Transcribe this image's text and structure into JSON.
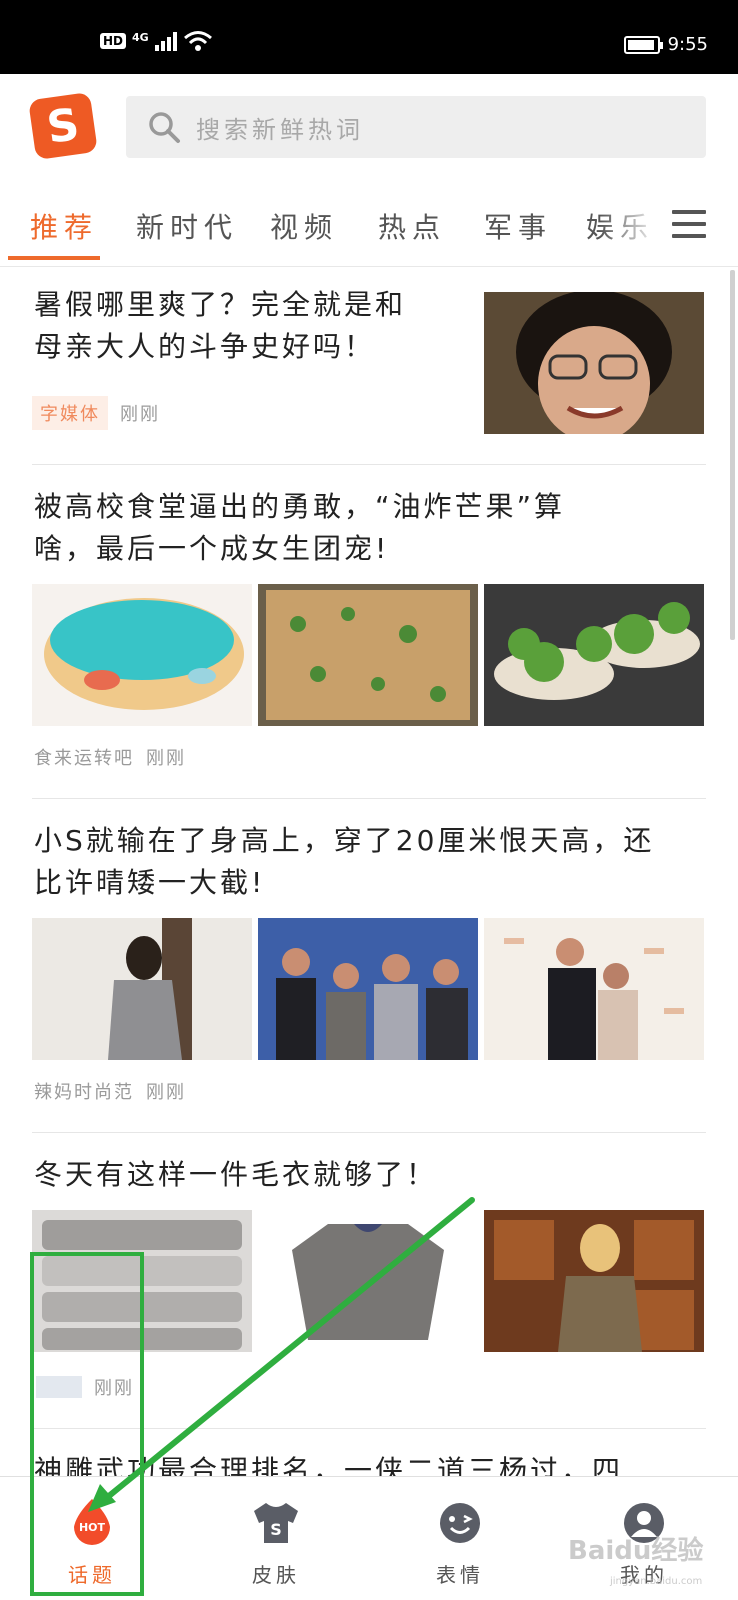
{
  "status_bar": {
    "hd": "HD",
    "network": "4G",
    "time": "9:55"
  },
  "header": {
    "logo_letter": "S",
    "search_placeholder": "搜索新鲜热词"
  },
  "tabs": [
    "推荐",
    "新时代",
    "视频",
    "热点",
    "军事",
    "娱乐"
  ],
  "active_tab": "推荐",
  "articles": [
    {
      "title_line1": "暑假哪里爽了？完全就是和",
      "title_line2": "母亲大人的斗争史好吗！",
      "tag": "字媒体",
      "time": "刚刚"
    },
    {
      "title_line1": "被高校食堂逼出的勇敢，“油炸芒果”算",
      "title_line2": "啥，最后一个成女生团宠!",
      "source": "食来运转吧",
      "time": "刚刚"
    },
    {
      "title_line1": "小S就输在了身高上，穿了20厘米恨天高，还",
      "title_line2": "比许晴矮一大截!",
      "source": "辣妈时尚范",
      "time": "刚刚"
    },
    {
      "title_line1": "冬天有这样一件毛衣就够了！",
      "time": "刚刚"
    },
    {
      "title_line1": "神雕武功最合理排名，一侠二道三杨过，四"
    }
  ],
  "bottom_nav": [
    {
      "label": "话题",
      "icon": "hot-icon",
      "badge": "HOT",
      "active": true
    },
    {
      "label": "皮肤",
      "icon": "tshirt-icon",
      "active": false
    },
    {
      "label": "表情",
      "icon": "emoji-icon",
      "active": false
    },
    {
      "label": "我的",
      "icon": "user-icon",
      "active": false
    }
  ],
  "watermark": {
    "brand": "Baidu经验",
    "url": "jingyan.baidu.com"
  },
  "colors": {
    "accent": "#ee6a2c",
    "annotation": "#2fae3f"
  }
}
